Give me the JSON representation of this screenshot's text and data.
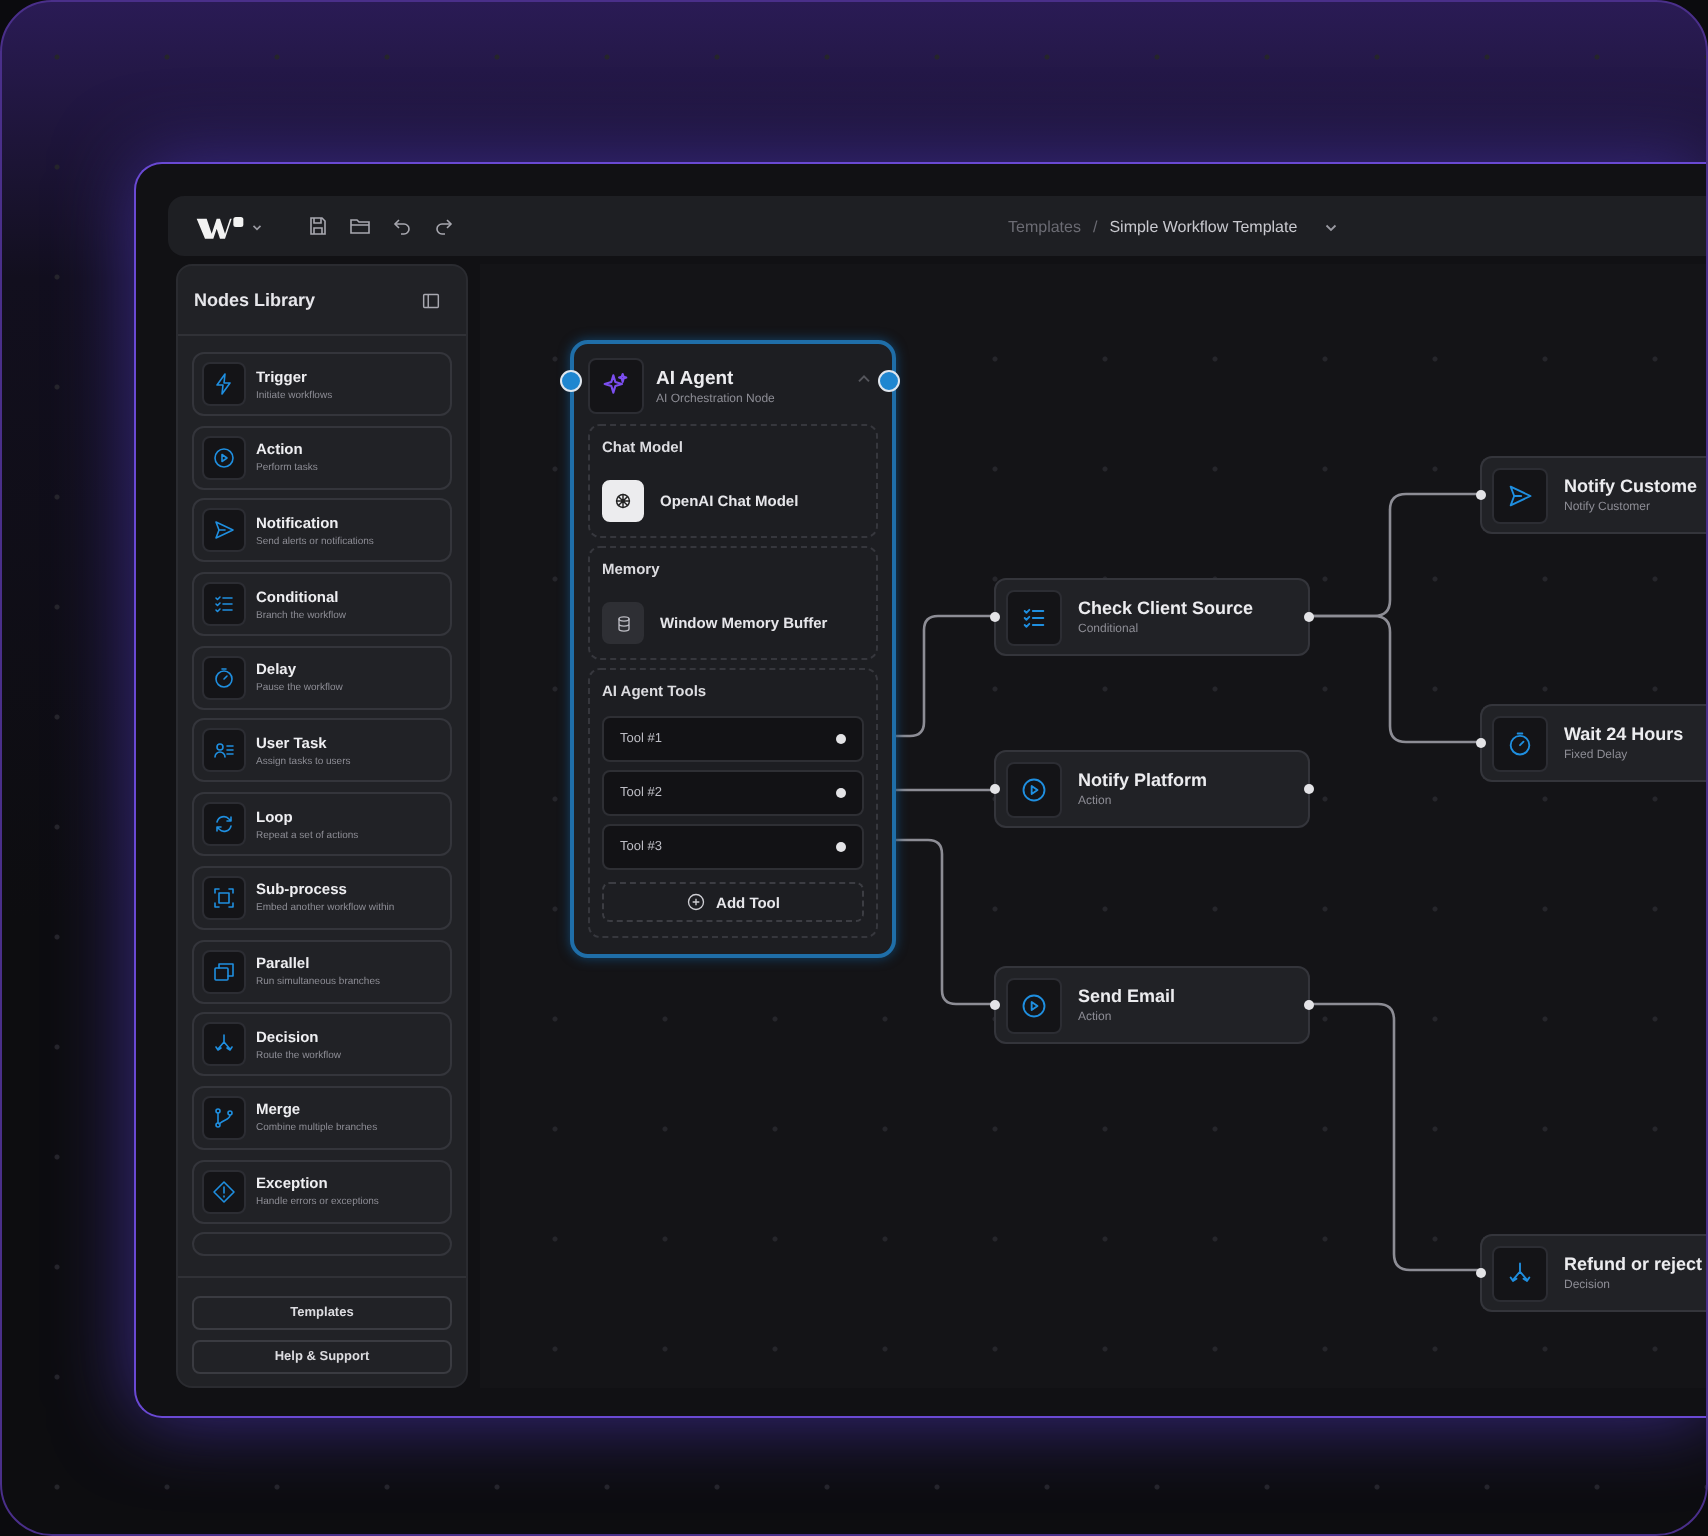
{
  "toolbar": {
    "breadcrumb": [
      {
        "label": "Templates",
        "selected": false
      },
      {
        "label": "Simple Workflow Template",
        "selected": true
      }
    ],
    "separator": "/"
  },
  "sidebar": {
    "title": "Nodes Library",
    "items": [
      {
        "kind": "trigger",
        "name": "Trigger",
        "description": "Initiate workflows"
      },
      {
        "kind": "action",
        "name": "Action",
        "description": "Perform tasks"
      },
      {
        "kind": "notification",
        "name": "Notification",
        "description": "Send alerts or notifications"
      },
      {
        "kind": "conditional",
        "name": "Conditional",
        "description": "Branch the workflow"
      },
      {
        "kind": "delay",
        "name": "Delay",
        "description": "Pause the workflow"
      },
      {
        "kind": "user_task",
        "name": "User Task",
        "description": "Assign tasks to users"
      },
      {
        "kind": "loop",
        "name": "Loop",
        "description": "Repeat a set of actions"
      },
      {
        "kind": "subprocess",
        "name": "Sub-process",
        "description": "Embed another workflow within"
      },
      {
        "kind": "parallel",
        "name": "Parallel",
        "description": "Run simultaneous branches"
      },
      {
        "kind": "decision",
        "name": "Decision",
        "description": "Route the workflow"
      },
      {
        "kind": "merge",
        "name": "Merge",
        "description": "Combine multiple branches"
      },
      {
        "kind": "exception",
        "name": "Exception",
        "description": "Handle errors or exceptions"
      }
    ],
    "footer_buttons": [
      "Templates",
      "Help & Support"
    ]
  },
  "canvas": {
    "agent": {
      "title": "AI Agent",
      "subtitle": "AI Orchestration Node",
      "expanded": true,
      "sections": [
        {
          "kind": "model",
          "title": "Chat Model",
          "item": "OpenAI Chat Model"
        },
        {
          "kind": "memory",
          "title": "Memory",
          "item": "Window Memory Buffer"
        },
        {
          "kind": "tools",
          "title": "AI Agent Tools",
          "tools": [
            "Tool #1",
            "Tool #2",
            "Tool #3"
          ],
          "add_label": "Add Tool"
        }
      ]
    },
    "nodes": [
      {
        "kind": "conditional",
        "title": "Check Client Source",
        "subtitle": "Conditional"
      },
      {
        "kind": "action",
        "title": "Notify Platform",
        "subtitle": "Action"
      },
      {
        "kind": "action",
        "title": "Send Email",
        "subtitle": "Action"
      },
      {
        "kind": "notification",
        "title": "Notify Custome",
        "subtitle": "Notify Customer"
      },
      {
        "kind": "delay",
        "title": "Wait 24 Hours",
        "subtitle": "Fixed Delay"
      },
      {
        "kind": "decision",
        "title": "Refund or reject",
        "subtitle": "Decision"
      }
    ]
  }
}
